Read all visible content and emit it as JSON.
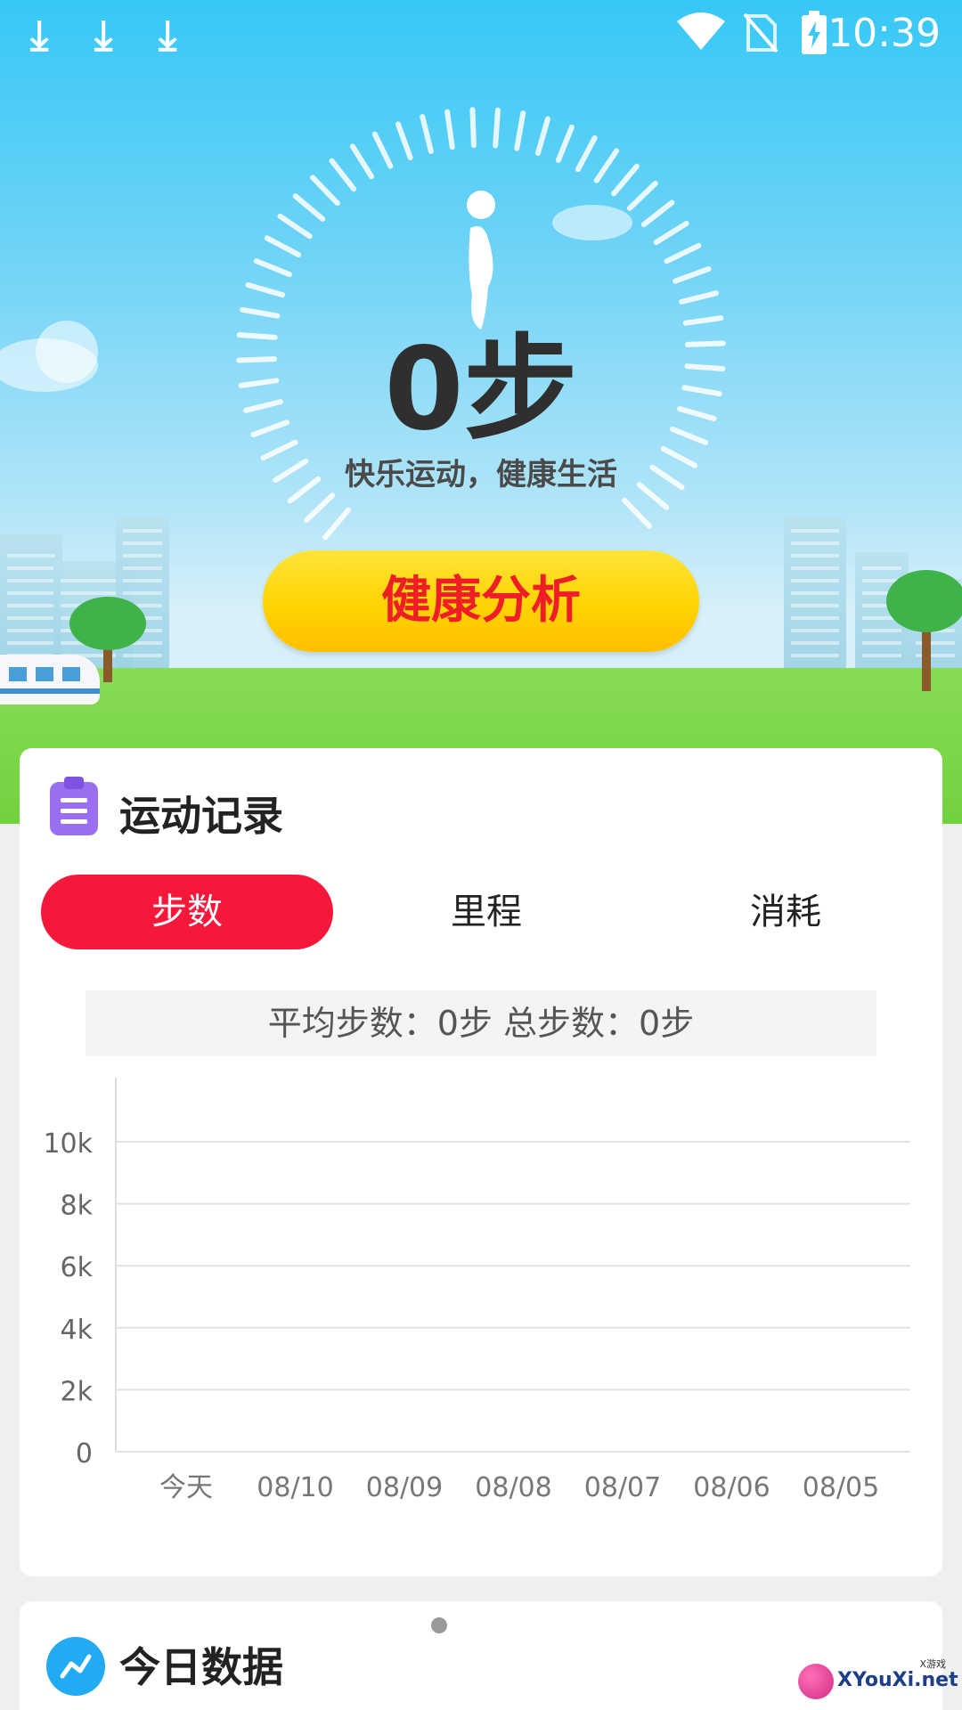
{
  "status_bar": {
    "time": "10:39",
    "download_icons": [
      "download-icon",
      "download-icon",
      "download-icon"
    ],
    "right_icons": [
      "wifi-icon",
      "no-sim-icon",
      "battery-charging-icon"
    ]
  },
  "hero": {
    "steps": "0步",
    "slogan": "快乐运动，健康生活",
    "analyze_button": "健康分析",
    "colors": {
      "button": "#ffd300",
      "button_text": "#ef1d25"
    }
  },
  "record_card": {
    "title": "运动记录",
    "tabs": [
      {
        "label": "步数",
        "active": true
      },
      {
        "label": "里程",
        "active": false
      },
      {
        "label": "消耗",
        "active": false
      }
    ],
    "summary": "平均步数：0步 总步数：0步",
    "accent": "#f5183a"
  },
  "chart_data": {
    "type": "bar",
    "categories": [
      "今天",
      "08/10",
      "08/09",
      "08/08",
      "08/07",
      "08/06",
      "08/05"
    ],
    "values": [
      0,
      0,
      0,
      0,
      0,
      0,
      0
    ],
    "yticks": [
      "0",
      "2k",
      "4k",
      "6k",
      "8k",
      "10k"
    ],
    "ylim": [
      0,
      10000
    ],
    "grid": true
  },
  "today_card": {
    "title": "今日数据"
  },
  "watermark": {
    "site": "XYouXi.net",
    "tag": "X游戏"
  }
}
